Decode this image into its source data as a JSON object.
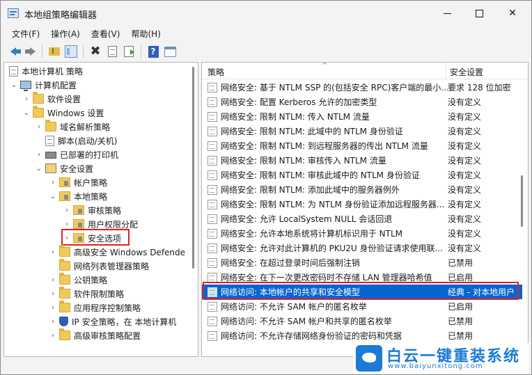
{
  "window": {
    "title": "本地组策略编辑器"
  },
  "menu": [
    "文件(F)",
    "操作(A)",
    "查看(V)",
    "帮助(H)"
  ],
  "toolbar": [
    "back-icon",
    "forward-icon",
    "up-folder-icon",
    "show-tree-icon",
    "delete-icon",
    "properties-icon",
    "export-icon",
    "help-icon",
    "view-icon"
  ],
  "tree": [
    {
      "label": "本地计算机 策略",
      "level": 0,
      "chevron": "",
      "icon": "policy-doc-icon"
    },
    {
      "label": "计算机配置",
      "level": 1,
      "chevron": "⌄",
      "icon": "computer-icon"
    },
    {
      "label": "软件设置",
      "level": 2,
      "chevron": "›",
      "icon": "folder-icon"
    },
    {
      "label": "Windows 设置",
      "level": 2,
      "chevron": "⌄",
      "icon": "folder-icon"
    },
    {
      "label": "域名解析策略",
      "level": 3,
      "chevron": "›",
      "icon": "folder-icon"
    },
    {
      "label": "脚本(启动/关机)",
      "level": 3,
      "chevron": "",
      "icon": "script-doc-icon"
    },
    {
      "label": "已部署的打印机",
      "level": 3,
      "chevron": "›",
      "icon": "printer-icon"
    },
    {
      "label": "安全设置",
      "level": 3,
      "chevron": "⌄",
      "icon": "security-settings-icon"
    },
    {
      "label": "帐户策略",
      "level": 4,
      "chevron": "›",
      "icon": "secure-folder-icon"
    },
    {
      "label": "本地策略",
      "level": 4,
      "chevron": "⌄",
      "icon": "secure-folder-icon"
    },
    {
      "label": "审核策略",
      "level": 5,
      "chevron": "›",
      "icon": "secure-folder-icon"
    },
    {
      "label": "用户权限分配",
      "level": 5,
      "chevron": "›",
      "icon": "secure-folder-icon"
    },
    {
      "label": "安全选项",
      "level": 5,
      "chevron": "›",
      "icon": "secure-folder-icon"
    },
    {
      "label": "高级安全 Windows Defende",
      "level": 4,
      "chevron": "›",
      "icon": "folder-icon"
    },
    {
      "label": "网络列表管理器策略",
      "level": 4,
      "chevron": "",
      "icon": "folder-icon"
    },
    {
      "label": "公钥策略",
      "level": 4,
      "chevron": "›",
      "icon": "folder-icon"
    },
    {
      "label": "软件限制策略",
      "level": 4,
      "chevron": "›",
      "icon": "folder-icon"
    },
    {
      "label": "应用程序控制策略",
      "level": 4,
      "chevron": "›",
      "icon": "folder-icon"
    },
    {
      "label": "IP 安全策略，在 本地计算机",
      "level": 4,
      "chevron": "›",
      "icon": "ip-shield-icon"
    },
    {
      "label": "高级审核策略配置",
      "level": 4,
      "chevron": "›",
      "icon": "folder-icon"
    }
  ],
  "list": {
    "columns": [
      "策略",
      "安全设置"
    ],
    "rows": [
      {
        "name": "网络安全: 基于 NTLM SSP 的(包括安全 RPC)客户端的最小...",
        "value": "要求 128 位加密"
      },
      {
        "name": "网络安全: 配置 Kerberos 允许的加密类型",
        "value": "没有定义"
      },
      {
        "name": "网络安全: 限制 NTLM: 传入 NTLM 流量",
        "value": "没有定义"
      },
      {
        "name": "网络安全: 限制 NTLM: 此域中的 NTLM 身份验证",
        "value": "没有定义"
      },
      {
        "name": "网络安全: 限制 NTLM: 到远程服务器的传出 NTLM 流量",
        "value": "没有定义"
      },
      {
        "name": "网络安全: 限制 NTLM: 审核传入 NTLM 流量",
        "value": "没有定义"
      },
      {
        "name": "网络安全: 限制 NTLM: 审核此域中的 NTLM 身份验证",
        "value": "没有定义"
      },
      {
        "name": "网络安全: 限制 NTLM: 添加此域中的服务器例外",
        "value": "没有定义"
      },
      {
        "name": "网络安全: 限制 NTLM: 为 NTLM 身份验证添加远程服务器...",
        "value": "没有定义"
      },
      {
        "name": "网络安全: 允许 LocalSystem NULL 会话回退",
        "value": "没有定义"
      },
      {
        "name": "网络安全: 允许本地系统将计算机标识用于 NTLM",
        "value": "没有定义"
      },
      {
        "name": "网络安全: 允许对此计算机的 PKU2U 身份验证请求使用联...",
        "value": "没有定义"
      },
      {
        "name": "网络安全: 在超过登录时间后强制注销",
        "value": "已禁用"
      },
      {
        "name": "网络安全: 在下一次更改密码时不存储 LAN 管理器哈希值",
        "value": "已启用"
      },
      {
        "name": "网络访问: 本地帐户的共享和安全模型",
        "value": "经典 - 对本地用户"
      },
      {
        "name": "网络访问: 不允许 SAM 帐户的匿名枚举",
        "value": "已启用"
      },
      {
        "name": "网络访问: 不允许 SAM 帐户和共享的匿名枚举",
        "value": "已禁用"
      },
      {
        "name": "网络访问: 不允许存储网络身份验证的密码和凭据",
        "value": "已禁用"
      }
    ]
  },
  "watermark": {
    "title": "白云一键重装系统",
    "url": "www.baiyunxitong.com"
  },
  "colors": {
    "selection": "#0a64d0",
    "highlight_box": "#e02020",
    "folder": "#f1c95a",
    "watermark": "#1b7bd6"
  }
}
